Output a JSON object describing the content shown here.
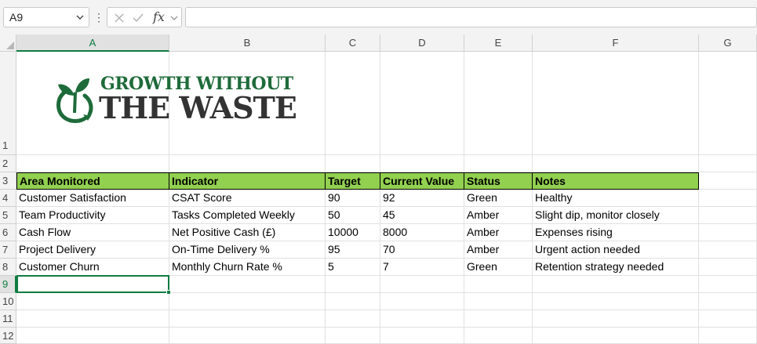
{
  "formula_bar": {
    "name_box": "A9",
    "fx_label": "fx",
    "formula": ""
  },
  "columns": [
    "A",
    "B",
    "C",
    "D",
    "E",
    "F",
    "G"
  ],
  "rows": [
    "1",
    "2",
    "3",
    "4",
    "5",
    "6",
    "7",
    "8",
    "9",
    "10",
    "11",
    "12"
  ],
  "selected": {
    "column": "A",
    "row": "9"
  },
  "logo": {
    "line1": "GROWTH WITHOUT",
    "line2": "THE WASTE",
    "icon": "sprout-recycle-icon"
  },
  "table": {
    "headers": [
      "Area Monitored",
      "Indicator",
      "Target",
      "Current Value",
      "Status",
      "Notes"
    ],
    "rows": [
      [
        "Customer Satisfaction",
        "CSAT Score",
        "90",
        "92",
        "Green",
        "Healthy"
      ],
      [
        "Team Productivity",
        "Tasks Completed Weekly",
        "50",
        "45",
        "Amber",
        "Slight dip, monitor closely"
      ],
      [
        "Cash Flow",
        "Net Positive Cash (£)",
        "10000",
        "8000",
        "Amber",
        "Expenses rising"
      ],
      [
        "Project Delivery",
        "On-Time Delivery %",
        "95",
        "70",
        "Amber",
        "Urgent action needed"
      ],
      [
        "Customer Churn",
        "Monthly Churn Rate %",
        "5",
        "7",
        "Green",
        "Retention strategy needed"
      ]
    ]
  },
  "colors": {
    "header_fill": "#92d050",
    "accent": "#107c41",
    "logo_green": "#1e6b3a",
    "logo_dark": "#333333"
  }
}
